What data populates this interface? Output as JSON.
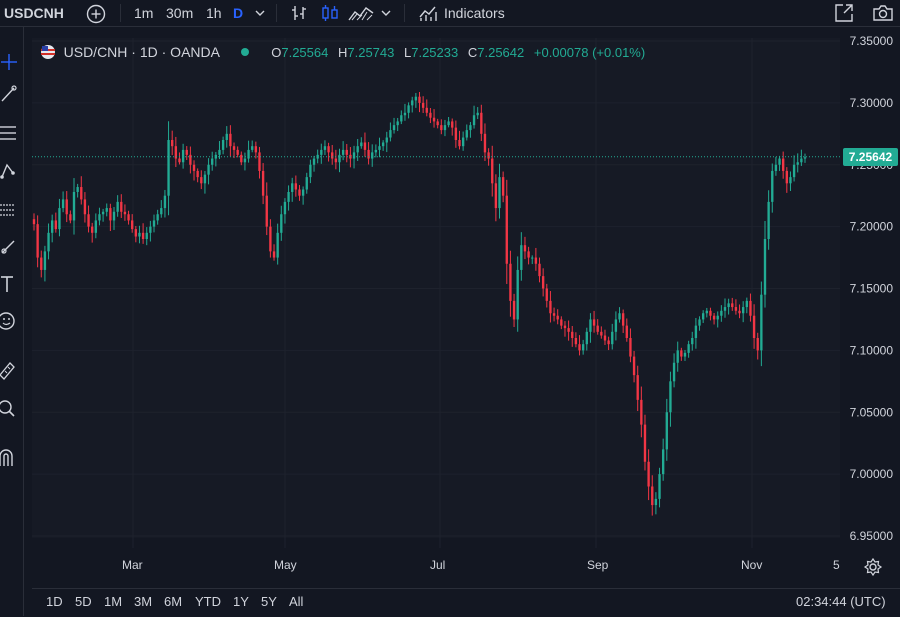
{
  "toolbar": {
    "symbol": "USDCNH",
    "intervals": [
      "1m",
      "30m",
      "1h",
      "D"
    ],
    "indicators_label": "Indicators"
  },
  "legend": {
    "title": "USD/CNH · 1D · OANDA",
    "o_label": "O",
    "o_value": "7.25564",
    "h_label": "H",
    "h_value": "7.25743",
    "l_label": "L",
    "l_value": "7.25233",
    "c_label": "C",
    "c_value": "7.25642",
    "change": "+0.00078 (+0.01%)"
  },
  "colors": {
    "up": "#22ab94",
    "down": "#f23645",
    "background": "#131722",
    "grid": "#1e222d",
    "accent": "#2962ff"
  },
  "chart_data": {
    "type": "candlestick",
    "title": "USD/CNH · 1D · OANDA",
    "ylim": [
      6.94,
      7.36
    ],
    "y_ticks": [
      "7.35000",
      "7.30000",
      "7.25000",
      "7.20000",
      "7.15000",
      "7.10000",
      "7.05000",
      "7.00000",
      "6.95000"
    ],
    "x_ticks": [
      "Mar",
      "May",
      "Jul",
      "Sep",
      "Nov",
      "5"
    ],
    "last_price": "7.25642",
    "grid": true,
    "close_series": [
      7.202,
      7.175,
      7.165,
      7.18,
      7.195,
      7.205,
      7.198,
      7.215,
      7.222,
      7.21,
      7.205,
      7.228,
      7.232,
      7.222,
      7.21,
      7.2,
      7.195,
      7.205,
      7.21,
      7.212,
      7.215,
      7.205,
      7.212,
      7.22,
      7.212,
      7.21,
      7.205,
      7.198,
      7.192,
      7.195,
      7.19,
      7.195,
      7.2,
      7.205,
      7.21,
      7.215,
      7.225,
      7.27,
      7.265,
      7.255,
      7.252,
      7.262,
      7.258,
      7.25,
      7.245,
      7.24,
      7.235,
      7.242,
      7.25,
      7.255,
      7.258,
      7.262,
      7.27,
      7.275,
      7.265,
      7.262,
      7.258,
      7.252,
      7.255,
      7.262,
      7.265,
      7.26,
      7.245,
      7.225,
      7.2,
      7.18,
      7.175,
      7.195,
      7.21,
      7.22,
      7.228,
      7.235,
      7.23,
      7.225,
      7.23,
      7.24,
      7.25,
      7.255,
      7.258,
      7.262,
      7.265,
      7.26,
      7.255,
      7.252,
      7.258,
      7.262,
      7.258,
      7.255,
      7.26,
      7.265,
      7.268,
      7.262,
      7.255,
      7.26,
      7.262,
      7.265,
      7.268,
      7.272,
      7.278,
      7.282,
      7.285,
      7.29,
      7.292,
      7.298,
      7.302,
      7.305,
      7.3,
      7.296,
      7.292,
      7.288,
      7.285,
      7.282,
      7.278,
      7.282,
      7.285,
      7.28,
      7.27,
      7.265,
      7.272,
      7.278,
      7.282,
      7.29,
      7.292,
      7.275,
      7.26,
      7.255,
      7.235,
      7.215,
      7.24,
      7.225,
      7.17,
      7.14,
      7.125,
      7.165,
      7.185,
      7.18,
      7.175,
      7.175,
      7.17,
      7.16,
      7.15,
      7.14,
      7.13,
      7.128,
      7.125,
      7.12,
      7.118,
      7.115,
      7.11,
      7.105,
      7.1,
      7.105,
      7.115,
      7.125,
      7.12,
      7.115,
      7.112,
      7.108,
      7.105,
      7.115,
      7.125,
      7.13,
      7.12,
      7.11,
      7.095,
      7.08,
      7.06,
      7.04,
      7.01,
      6.99,
      6.975,
      6.98,
      7.0,
      7.02,
      7.05,
      7.075,
      7.09,
      7.1,
      7.095,
      7.098,
      7.105,
      7.11,
      7.12,
      7.125,
      7.13,
      7.132,
      7.128,
      7.125,
      7.128,
      7.132,
      7.135,
      7.138,
      7.135,
      7.132,
      7.13,
      7.135,
      7.14,
      7.128,
      7.11,
      7.1,
      7.145,
      7.19,
      7.22,
      7.245,
      7.25,
      7.255,
      7.245,
      7.235,
      7.24,
      7.25,
      7.252,
      7.255,
      7.256
    ]
  },
  "bottom": {
    "ranges": [
      "1D",
      "5D",
      "1M",
      "3M",
      "6M",
      "YTD",
      "1Y",
      "5Y",
      "All"
    ],
    "time": "02:34:44 (UTC)"
  }
}
